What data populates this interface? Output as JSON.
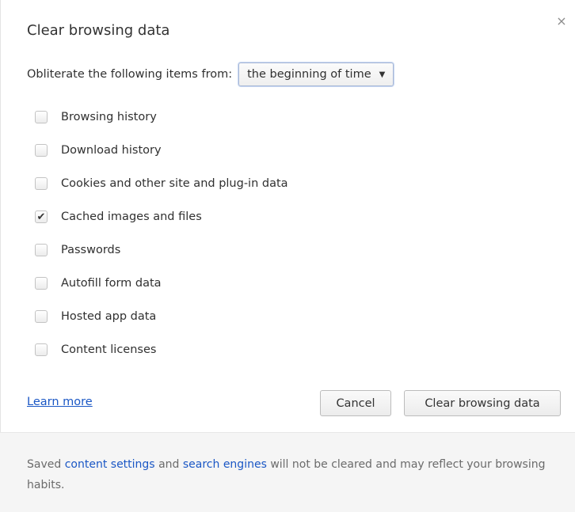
{
  "dialog": {
    "title": "Clear browsing data",
    "close_label": "×"
  },
  "range": {
    "label": "Obliterate the following items from:",
    "selected": "the beginning of time",
    "chevron": "▼"
  },
  "options": [
    {
      "label": "Browsing history",
      "checked": false
    },
    {
      "label": "Download history",
      "checked": false
    },
    {
      "label": "Cookies and other site and plug-in data",
      "checked": false
    },
    {
      "label": "Cached images and files",
      "checked": true
    },
    {
      "label": "Passwords",
      "checked": false
    },
    {
      "label": "Autofill form data",
      "checked": false
    },
    {
      "label": "Hosted app data",
      "checked": false
    },
    {
      "label": "Content licenses",
      "checked": false
    }
  ],
  "check_glyph": "✔",
  "actions": {
    "learn_more": "Learn more",
    "cancel": "Cancel",
    "clear": "Clear browsing data"
  },
  "footer": {
    "prefix": "Saved",
    "content_settings_link": "content settings",
    "and": "and",
    "search_engines_link": "search engines",
    "suffix": "will not be cleared and may reflect your browsing habits."
  },
  "colors": {
    "link": "#1a57c5",
    "footer_background": "#f5f5f5"
  }
}
